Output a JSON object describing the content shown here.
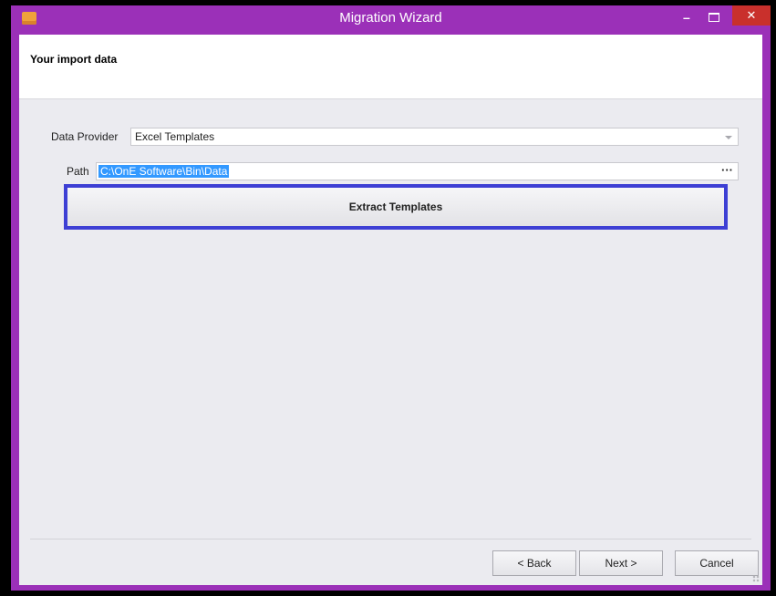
{
  "window": {
    "title": "Migration Wizard",
    "minimize_glyph": "–",
    "close_glyph": "✕"
  },
  "header": {
    "title": "Your import data"
  },
  "form": {
    "data_provider_label": "Data Provider",
    "data_provider_value": "Excel Templates",
    "path_label": "Path",
    "path_value": "C:\\OnE Software\\Bin\\Data",
    "browse_label": "···"
  },
  "actions": {
    "extract_label": "Extract Templates"
  },
  "footer": {
    "back_label": "< Back",
    "next_label": "Next >",
    "cancel_label": "Cancel"
  },
  "colors": {
    "title_bar": "#9b30b8",
    "close_button": "#c9302c",
    "focus_border": "#3d3fd4",
    "selection": "#3399ff"
  }
}
